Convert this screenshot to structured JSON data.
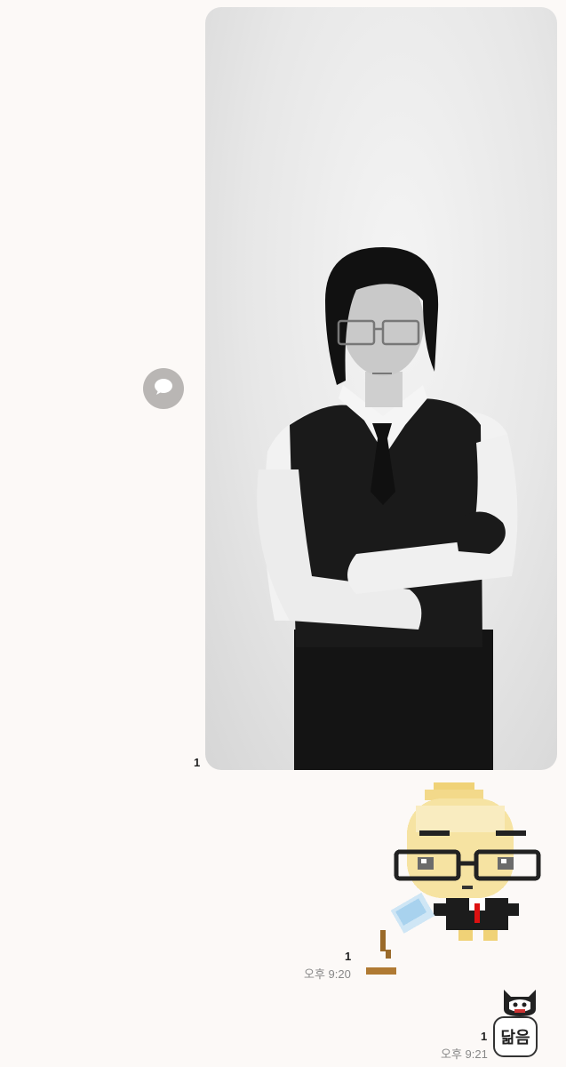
{
  "messages": [
    {
      "type": "photo",
      "unread_count": "1",
      "image_alt": "black-and-white portrait of a man with glasses in a vest and tie, arms crossed"
    },
    {
      "type": "sticker",
      "unread_count": "1",
      "time": "오후 9:20",
      "sticker_name": "pixel-dumpling-character-with-glasses"
    },
    {
      "type": "sticker",
      "unread_count": "1",
      "time": "오후 9:21",
      "sticker_text": "닮음"
    }
  ],
  "icons": {
    "share": "speech-bubble-icon"
  },
  "colors": {
    "background": "#fcf9f7",
    "share_button": "#b9b6b4",
    "timestamp": "#888888",
    "unread": "#222222"
  }
}
